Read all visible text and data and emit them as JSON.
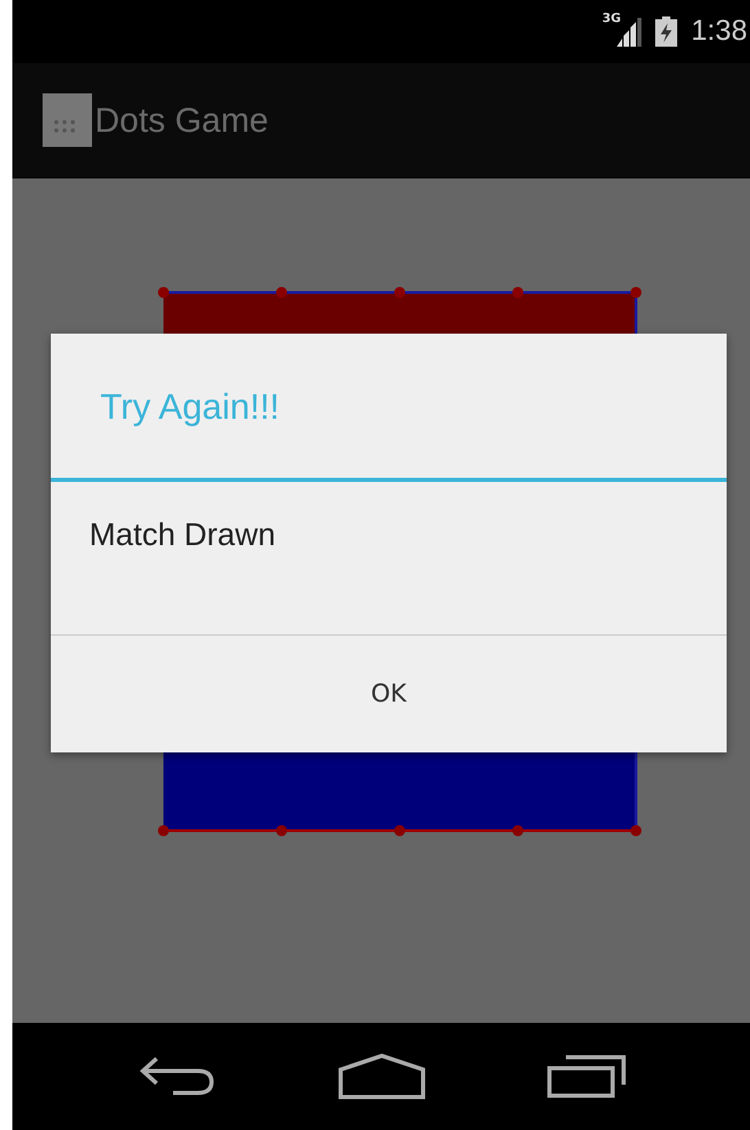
{
  "status_bar": {
    "network": "3G",
    "time": "1:38"
  },
  "action_bar": {
    "title": "Dots Game"
  },
  "dialog": {
    "title": "Try Again!!!",
    "message": "Match Drawn",
    "buttons": [
      "OK"
    ]
  }
}
